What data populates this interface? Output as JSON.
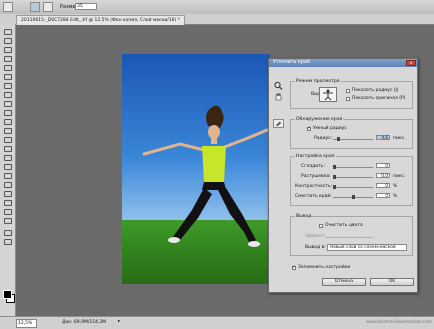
{
  "options_bar": {
    "size_label": "Размер:",
    "size_value": "35"
  },
  "document": {
    "tab_title": "20110615-_DSC7284 Edit_.tif @ 12,5% (Фон копия, Слой маски/16) *"
  },
  "status_bar": {
    "zoom": "12,5%",
    "doc_info": "Док: 69,9M/154,3M",
    "arrow": "▸",
    "watermark": "www.bestreviewsmarket.com"
  },
  "dialog": {
    "title": "Уточнить край",
    "close_glyph": "x",
    "view_mode": {
      "group_label": "Режим просмотра",
      "view_label": "Вид:",
      "show_radius_label": "Показать радиус (J)",
      "show_original_label": "Показать оригинал (P)"
    },
    "edge_detection": {
      "group_label": "Обнаружение края",
      "smart_radius_label": "Умный радиус",
      "radius_label": "Радиус:",
      "radius_value": "4,6",
      "radius_unit": "пикс."
    },
    "adjust_edge": {
      "group_label": "Настройка края",
      "smooth_label": "Сгладить:",
      "smooth_value": "0",
      "feather_label": "Растушевка:",
      "feather_value": "0,0",
      "feather_unit": "пикс.",
      "contrast_label": "Контрастность:",
      "contrast_value": "0",
      "contrast_unit": "%",
      "shift_label": "Сместить край:",
      "shift_value": "0",
      "shift_unit": "%"
    },
    "output": {
      "group_label": "Вывод",
      "decontaminate_label": "Очистить цвета",
      "amount_label": "Эффект:",
      "output_to_label": "Вывод в:",
      "output_to_value": "Новый слой со слоем-маской"
    },
    "remember_label": "Запомнить настройки",
    "cancel_label": "Отмена",
    "ok_label": "OK"
  },
  "colors": {
    "title_bar": "#5d82b6",
    "sky": "#1b57b5",
    "grass": "#2f7d1c"
  }
}
